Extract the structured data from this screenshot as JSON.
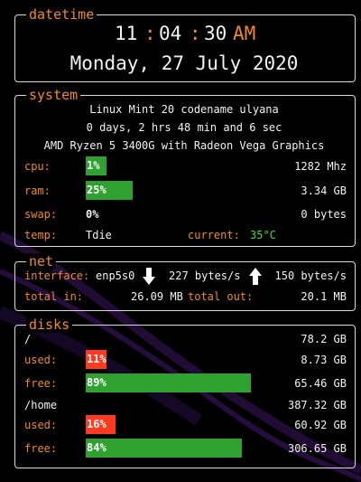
{
  "datetime": {
    "title": "datetime",
    "hour": "11",
    "colon1": ":",
    "minute": "04",
    "colon2": ":",
    "second": "30",
    "ampm": "AM",
    "date": "Monday, 27 July 2020"
  },
  "system": {
    "title": "system",
    "os": "Linux Mint 20 codename ulyana",
    "uptime": "0 days, 2 hrs 48 min and 6 sec",
    "cpu_model": "AMD Ryzen 5 3400G with Radeon Vega Graphics",
    "cpu": {
      "label": "cpu:",
      "percent": "1%",
      "level": 1,
      "freq": "1282 Mhz"
    },
    "ram": {
      "label": "ram:",
      "percent": "25%",
      "level": 25,
      "amount": "3.34 GB"
    },
    "swap": {
      "label": "swap:",
      "percent": "0%",
      "level": 0,
      "amount": "0 bytes"
    },
    "temp": {
      "label": "temp:",
      "sensor": "Tdie",
      "current_label": "current:",
      "current_value": "35°C"
    }
  },
  "net": {
    "title": "net",
    "interface_label": "interface:",
    "interface": "enp5s0",
    "down_speed": "227 bytes/s",
    "up_speed": "150 bytes/s",
    "total_in_label": "total in:",
    "total_in": "26.09 MB",
    "total_out_label": "total out:",
    "total_out": "20.1 MB"
  },
  "disks": {
    "title": "disks",
    "items": [
      {
        "mount": "/",
        "size": "78.2 GB",
        "used_label": "used:",
        "used_percent": "11%",
        "used_level": 11,
        "used_amount": "8.73 GB",
        "free_label": "free:",
        "free_percent": "89%",
        "free_level": 89,
        "free_amount": "65.46 GB"
      },
      {
        "mount": "/home",
        "size": "387.32 GB",
        "used_label": "used:",
        "used_percent": "16%",
        "used_level": 16,
        "used_amount": "60.92 GB",
        "free_label": "free:",
        "free_percent": "84%",
        "free_level": 84,
        "free_amount": "306.65 GB"
      }
    ]
  },
  "colors": {
    "accent": "#f08a24",
    "bar_green": "#2fa12f",
    "bar_red": "#ff3a1e",
    "temp_ok": "#3ddc3d"
  }
}
